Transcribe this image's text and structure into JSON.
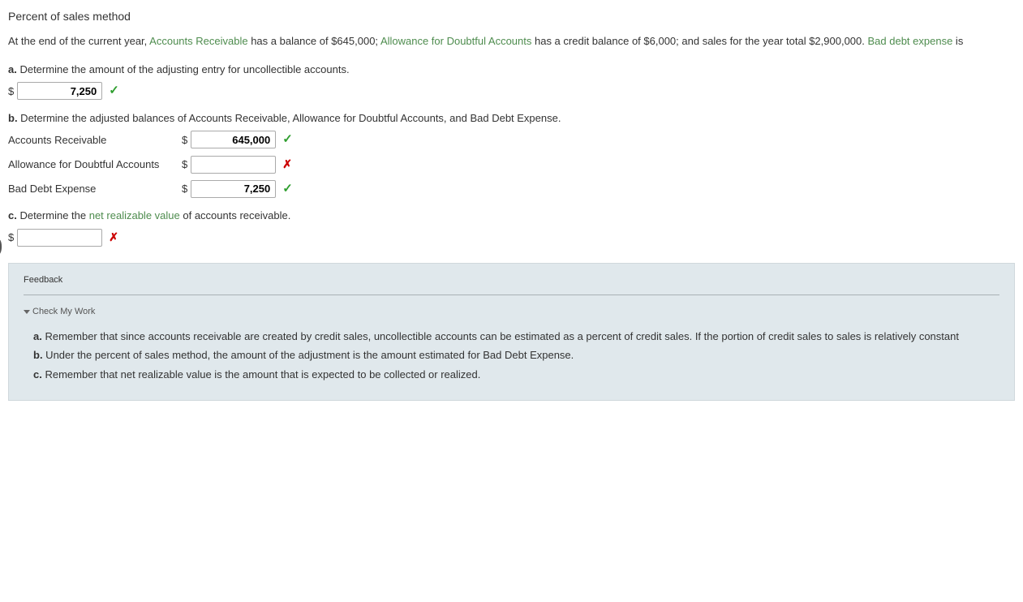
{
  "title": "Percent of sales method",
  "intro": {
    "t1": "At the end of the current year, ",
    "g1": "Accounts Receivable",
    "t2": " has a balance of $645,000; ",
    "g2": "Allowance for Doubtful Accounts",
    "t3": " has a credit balance of $6,000; and sales for the year total $2,900,000. ",
    "g3": "Bad debt expense",
    "t4": " is"
  },
  "qa": {
    "letter": "a.",
    "prompt": "  Determine the amount of the adjusting entry for uncollectible accounts.",
    "value": "7,250"
  },
  "qb": {
    "letter": "b.",
    "prompt": "  Determine the adjusted balances of Accounts Receivable, Allowance for Doubtful Accounts, and Bad Debt Expense.",
    "rows": [
      {
        "label": "Accounts Receivable",
        "value": "645,000",
        "status": "check"
      },
      {
        "label": "Allowance for Doubtful Accounts",
        "value": "",
        "status": "x"
      },
      {
        "label": "Bad Debt Expense",
        "value": "7,250",
        "status": "check"
      }
    ]
  },
  "qc": {
    "letter": "c.",
    "t1": "  Determine the ",
    "g1": "net realizable value",
    "t2": " of accounts receivable.",
    "value": ""
  },
  "feedback": {
    "title": "Feedback",
    "toggle": "Check My Work",
    "hints": [
      {
        "letter": "a.",
        "text": " Remember that since accounts receivable are created by credit sales, uncollectible accounts can be estimated as a percent of credit sales. If the portion of credit sales to sales is relatively constant"
      },
      {
        "letter": "b.",
        "text": " Under the percent of sales method, the amount of the adjustment is the amount estimated for Bad Debt Expense."
      },
      {
        "letter": "c.",
        "text": " Remember that net realizable value is the amount that is expected to be collected or realized."
      }
    ]
  },
  "glyphs": {
    "check": "✓",
    "x": "✗",
    "dollar": "$"
  }
}
